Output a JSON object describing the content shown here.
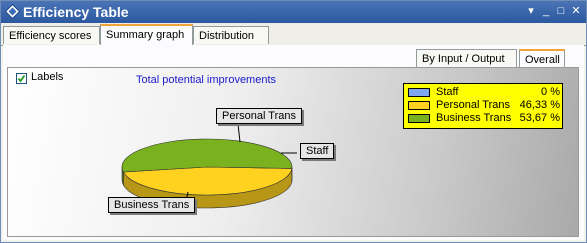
{
  "window": {
    "title": "Efficiency Table",
    "controls": [
      "▾",
      "_",
      "□",
      "✕"
    ]
  },
  "tabs": [
    {
      "label": "Efficiency scores",
      "active": false
    },
    {
      "label": "Summary graph",
      "active": true
    },
    {
      "label": "Distribution",
      "active": false
    }
  ],
  "subtabs": [
    {
      "label": "By Input / Output",
      "active": false
    },
    {
      "label": "Overall",
      "active": true
    }
  ],
  "labels_checkbox": {
    "label": "Labels",
    "checked": true
  },
  "chart_data": {
    "type": "pie",
    "title": "Total potential improvements",
    "slices": [
      {
        "name": "Staff",
        "value": 0,
        "pct_text": "0 %",
        "color": "#7fa8f0"
      },
      {
        "name": "Personal Trans",
        "value": 46.33,
        "pct_text": "46,33 %",
        "color": "#ffd21f"
      },
      {
        "name": "Business Trans",
        "value": 53.67,
        "pct_text": "53,67 %",
        "color": "#7ab21f"
      }
    ],
    "legend_position": "top-right",
    "legend_background": "#ffff00"
  }
}
